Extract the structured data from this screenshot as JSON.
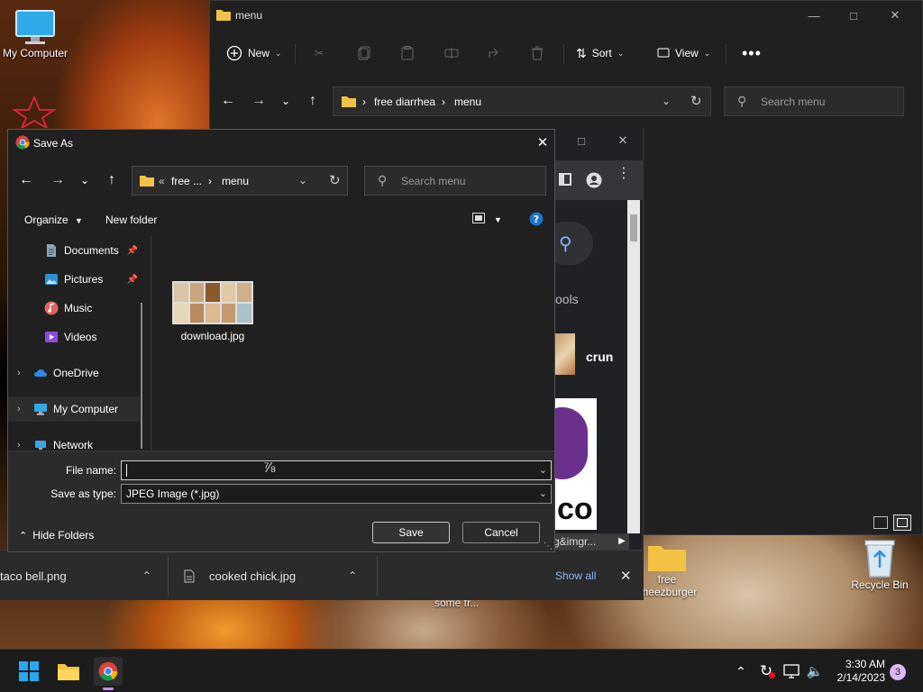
{
  "desktop": {
    "my_computer": "My Computer",
    "recycle_bin": "Recycle Bin",
    "folder_label": "free\ncheezburger",
    "folder_label_line1": "free",
    "folder_label_line2": "cheezburger",
    "behind_text": "some fr..."
  },
  "explorer": {
    "title": "menu",
    "new_label": "New",
    "sort_label": "Sort",
    "view_label": "View",
    "crumb1": "free diarrhea",
    "crumb2": "menu",
    "search_placeholder": "Search menu"
  },
  "chrome": {
    "tools_text": "ools",
    "result_text": "crun",
    "url_text": "g&imgr..."
  },
  "downloads": {
    "item1": "taco bell.png",
    "item2": "cooked chick.jpg",
    "show_all": "Show all"
  },
  "dialog": {
    "title": "Save As",
    "crumb_short": "free ...",
    "crumb_current": "menu",
    "search_placeholder": "Search menu",
    "organize": "Organize",
    "new_folder": "New folder",
    "nav": {
      "documents": "Documents",
      "pictures": "Pictures",
      "music": "Music",
      "videos": "Videos",
      "onedrive": "OneDrive",
      "my_computer": "My Computer",
      "network": "Network"
    },
    "file_name": "download.jpg",
    "file_name_label": "File name:",
    "file_name_value": "",
    "save_type_label": "Save as type:",
    "save_type_value": "JPEG Image (*.jpg)",
    "hide_folders": "Hide Folders",
    "save": "Save",
    "cancel": "Cancel"
  },
  "taskbar": {
    "time": "3:30 AM",
    "date": "2/14/2023",
    "notif_count": "3"
  },
  "colors": {
    "accent": "#4cc2ff",
    "dialog_bg": "#202020",
    "taskbar_bg": "#1c1c1c"
  }
}
